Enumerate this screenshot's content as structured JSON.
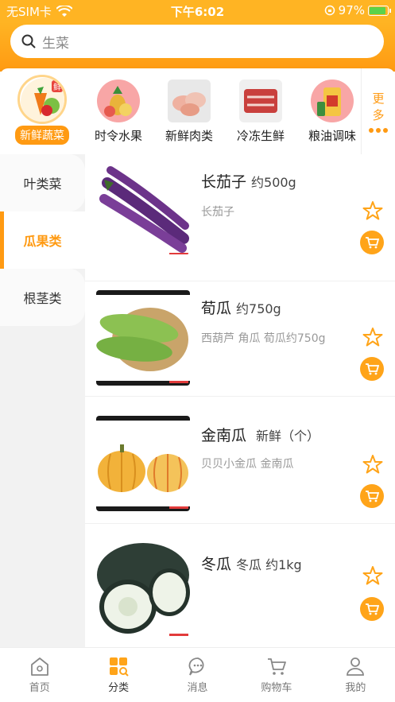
{
  "status_bar": {
    "carrier": "无SIM卡",
    "time": "下午6:02",
    "battery": "97%"
  },
  "search": {
    "placeholder": "生菜"
  },
  "categories": [
    {
      "label": "新鲜蔬菜",
      "icon": "vegetables-icon"
    },
    {
      "label": "时令水果",
      "icon": "fruit-icon"
    },
    {
      "label": "新鲜肉类",
      "icon": "meat-icon"
    },
    {
      "label": "冷冻生鲜",
      "icon": "frozen-meat-icon"
    },
    {
      "label": "粮油调味",
      "icon": "grain-oil-icon"
    }
  ],
  "categories_badge": "鲜",
  "more": {
    "line1": "更",
    "line2": "多"
  },
  "sidebar": {
    "items": [
      {
        "label": "叶类菜"
      },
      {
        "label": "瓜果类"
      },
      {
        "label": "根茎类"
      }
    ]
  },
  "products": [
    {
      "name": "长茄子",
      "spec": "约500g",
      "desc": "长茄子"
    },
    {
      "name": "荀瓜",
      "spec": "约750g",
      "desc": "西葫芦 角瓜 荀瓜约750g"
    },
    {
      "name": "金南瓜",
      "spec": "新鲜（个）",
      "desc": "贝贝小金瓜 金南瓜"
    },
    {
      "name": "冬瓜",
      "spec": "冬瓜 约1kg",
      "desc": ""
    }
  ],
  "tabs": [
    {
      "label": "首页",
      "icon": "home-icon"
    },
    {
      "label": "分类",
      "icon": "category-icon"
    },
    {
      "label": "消息",
      "icon": "message-icon"
    },
    {
      "label": "购物车",
      "icon": "cart-icon"
    },
    {
      "label": "我的",
      "icon": "profile-icon"
    }
  ],
  "colors": {
    "accent": "#FF9A12",
    "header": "#FFB423",
    "sidebar_bg": "#f2f2f2"
  }
}
